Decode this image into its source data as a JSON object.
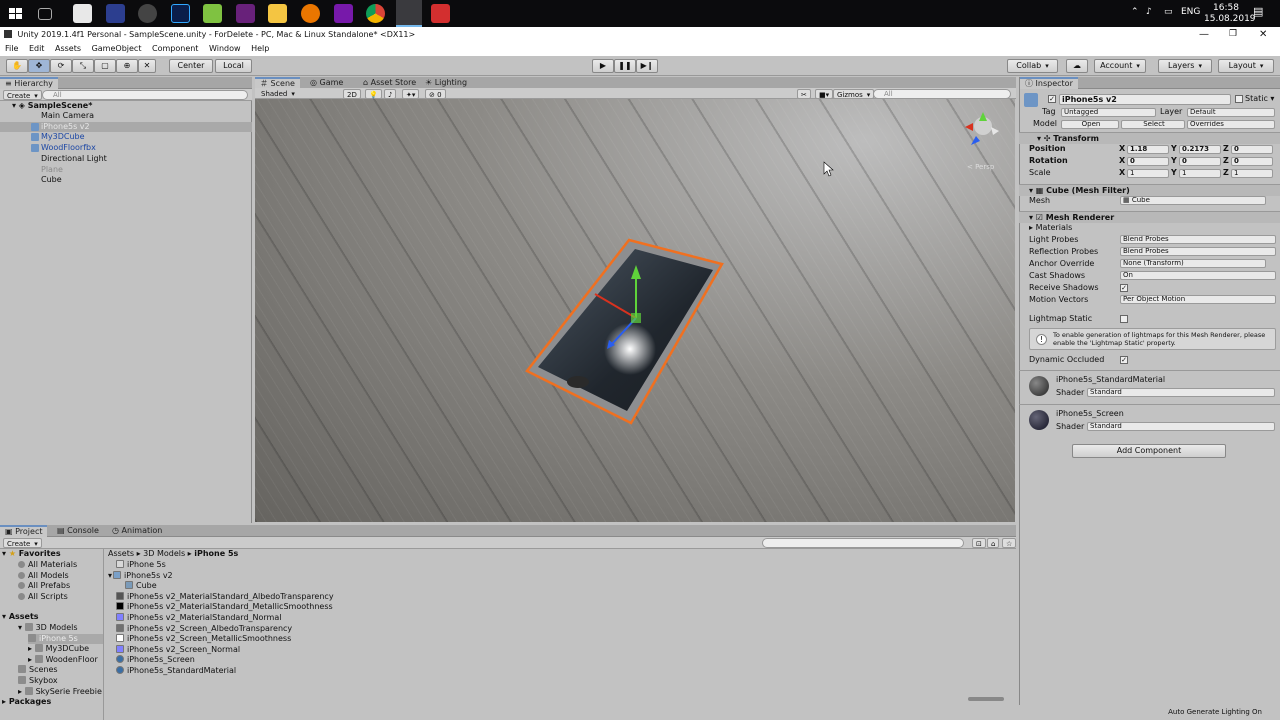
{
  "taskbar": {
    "lang": "ENG",
    "time": "16:58",
    "date": "15.08.2019",
    "icons": [
      "windows-icon",
      "task-view-icon",
      "cmd-icon",
      "app-icon",
      "obs-icon",
      "photoshop-icon",
      "notepadpp-icon",
      "visual-studio-icon",
      "file-explorer-icon",
      "blender-icon",
      "onenote-icon",
      "chrome-icon",
      "unity-icon",
      "app-red-icon"
    ]
  },
  "window": {
    "title": "Unity 2019.1.4f1 Personal - SampleScene.unity - ForDelete - PC, Mac & Linux Standalone* <DX11>",
    "menu": [
      "File",
      "Edit",
      "Assets",
      "GameObject",
      "Component",
      "Window",
      "Help"
    ]
  },
  "toolbar": {
    "center": "Center",
    "local": "Local",
    "collab": "Collab",
    "account": "Account",
    "layers": "Layers",
    "layout": "Layout"
  },
  "hierarchy": {
    "tab": "Hierarchy",
    "create": "Create",
    "search": "All",
    "scene": "SampleScene*",
    "items": [
      {
        "label": "Main Camera",
        "style": "normal"
      },
      {
        "label": "iPhone5s v2",
        "style": "selected"
      },
      {
        "label": "My3DCube",
        "style": "prefab"
      },
      {
        "label": "WoodFloorfbx",
        "style": "prefab"
      },
      {
        "label": "Directional Light",
        "style": "normal"
      },
      {
        "label": "Plane",
        "style": "disabled"
      },
      {
        "label": "Cube",
        "style": "normal"
      }
    ]
  },
  "scene": {
    "tabs": [
      "Scene",
      "Game",
      "Asset Store",
      "Lighting"
    ],
    "shading": "Shaded",
    "mode2d": "2D",
    "fx_count": "0",
    "gizmos": "Gizmos",
    "search": "All",
    "persp": "< Persp"
  },
  "inspector": {
    "tab": "Inspector",
    "object_name": "iPhone5s v2",
    "static": "Static",
    "tag_label": "Tag",
    "tag": "Untagged",
    "layer_label": "Layer",
    "layer": "Default",
    "model_label": "Model",
    "open": "Open",
    "select": "Select",
    "overrides": "Overrides",
    "transform": {
      "title": "Transform",
      "position_label": "Position",
      "rotation_label": "Rotation",
      "scale_label": "Scale",
      "position": [
        "1.18",
        "0.2173",
        "0"
      ],
      "rotation": [
        "0",
        "0",
        "0"
      ],
      "scale": [
        "1",
        "1",
        "1"
      ]
    },
    "mesh_filter": {
      "title": "Cube (Mesh Filter)",
      "mesh_label": "Mesh",
      "mesh": "Cube"
    },
    "mesh_renderer": {
      "title": "Mesh Renderer",
      "materials": "Materials",
      "light_probes_label": "Light Probes",
      "light_probes": "Blend Probes",
      "reflection_probes_label": "Reflection Probes",
      "reflection_probes": "Blend Probes",
      "anchor_override_label": "Anchor Override",
      "anchor_override": "None (Transform)",
      "cast_shadows_label": "Cast Shadows",
      "cast_shadows": "On",
      "receive_shadows_label": "Receive Shadows",
      "motion_vectors_label": "Motion Vectors",
      "motion_vectors": "Per Object Motion",
      "lightmap_static_label": "Lightmap Static",
      "info": "To enable generation of lightmaps for this Mesh Renderer, please enable the 'Lightmap Static' property.",
      "dynamic_occluded_label": "Dynamic Occluded"
    },
    "materials": [
      {
        "name": "iPhone5s_StandardMaterial",
        "shader_label": "Shader",
        "shader": "Standard"
      },
      {
        "name": "iPhone5s_Screen",
        "shader_label": "Shader",
        "shader": "Standard"
      }
    ],
    "add_component": "Add Component"
  },
  "project": {
    "tabs": [
      "Project",
      "Console",
      "Animation"
    ],
    "create": "Create",
    "favorites_label": "Favorites",
    "favorites": [
      "All Materials",
      "All Models",
      "All Prefabs",
      "All Scripts"
    ],
    "assets_label": "Assets",
    "tree": [
      {
        "label": "3D Models",
        "indent": 1
      },
      {
        "label": "iPhone 5s",
        "indent": 2
      },
      {
        "label": "My3DCube",
        "indent": 2
      },
      {
        "label": "WoodenFloor",
        "indent": 2
      },
      {
        "label": "Scenes",
        "indent": 1
      },
      {
        "label": "Skybox",
        "indent": 1
      },
      {
        "label": "SkySerie Freebie",
        "indent": 1
      }
    ],
    "packages_label": "Packages",
    "breadcrumb": [
      "Assets",
      "3D Models",
      "iPhone 5s"
    ],
    "files": [
      {
        "label": "iPhone 5s",
        "icon": "file",
        "color": "#d8d8d8"
      },
      {
        "label": "iPhone5s v2",
        "icon": "prefab",
        "color": "#7aa0c8"
      },
      {
        "label": "Cube",
        "icon": "mesh",
        "color": "#7a9ab8"
      },
      {
        "label": "iPhone5s v2_MaterialStandard_AlbedoTransparency",
        "icon": "texture",
        "color": "#555555"
      },
      {
        "label": "iPhone5s v2_MaterialStandard_MetallicSmoothness",
        "icon": "texture",
        "color": "#000000"
      },
      {
        "label": "iPhone5s v2_MaterialStandard_Normal",
        "icon": "texture",
        "color": "#8080ff"
      },
      {
        "label": "iPhone5s v2_Screen_AlbedoTransparency",
        "icon": "texture",
        "color": "#707070"
      },
      {
        "label": "iPhone5s v2_Screen_MetallicSmoothness",
        "icon": "texture",
        "color": "#ffffff"
      },
      {
        "label": "iPhone5s v2_Screen_Normal",
        "icon": "texture",
        "color": "#8080ff"
      },
      {
        "label": "iPhone5s_Screen",
        "icon": "material",
        "color": "#3a6ea5"
      },
      {
        "label": "iPhone5s_StandardMaterial",
        "icon": "material",
        "color": "#3a6ea5"
      }
    ],
    "footer": "Auto Generate Lighting On"
  }
}
